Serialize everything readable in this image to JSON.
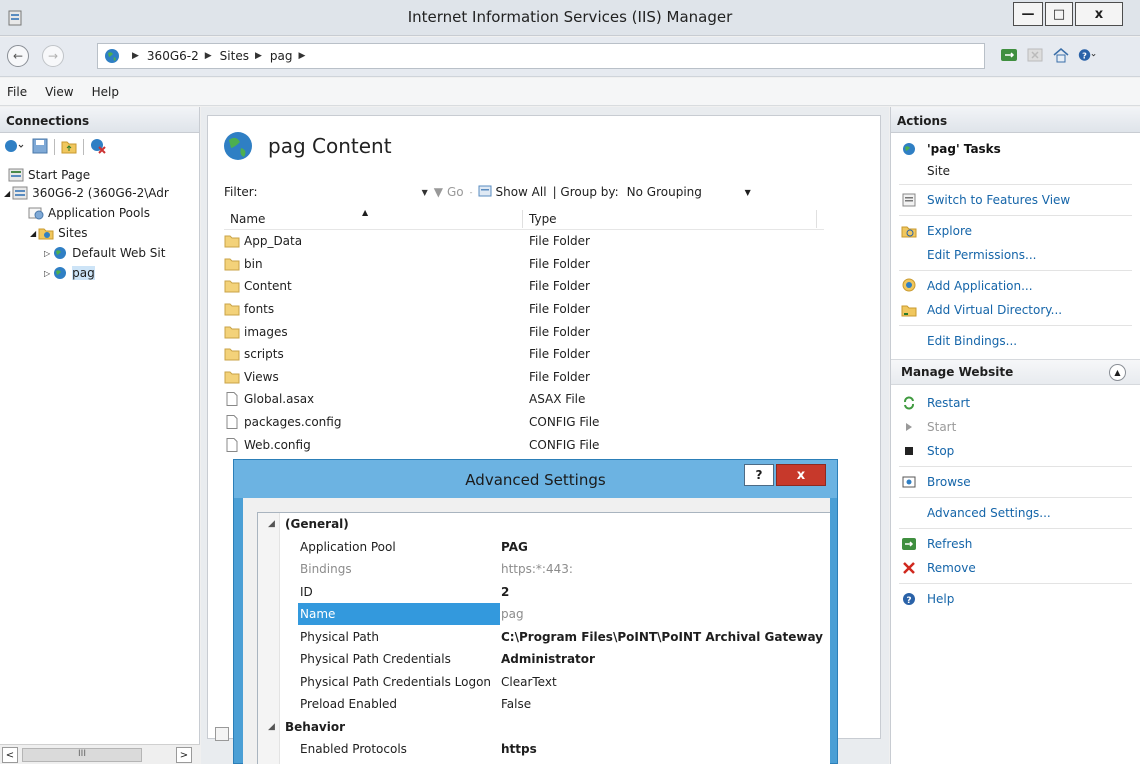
{
  "window": {
    "title": "Internet Information Services (IIS) Manager",
    "minimize": "—",
    "maximize": "□",
    "close": "x"
  },
  "address": {
    "crumbs": [
      "360G6-2",
      "Sites",
      "pag"
    ]
  },
  "menu": {
    "items": [
      "File",
      "View",
      "Help"
    ]
  },
  "connections": {
    "header": "Connections",
    "tree": [
      {
        "label": "Start Page",
        "icon": "start-page-icon"
      },
      {
        "label": "360G6-2 (360G6-2\\Adr",
        "icon": "server-icon"
      },
      {
        "label": "Application Pools",
        "icon": "app-pools-icon"
      },
      {
        "label": "Sites",
        "icon": "sites-folder-icon"
      },
      {
        "label": "Default Web Sit",
        "icon": "website-globe-icon"
      },
      {
        "label": "pag",
        "icon": "website-globe-icon"
      }
    ],
    "scroll_thumb": "III"
  },
  "content": {
    "title": "pag Content",
    "filter_label": "Filter:",
    "go_label": "Go",
    "show_all_label": "Show All",
    "group_by_label": "| Group by:",
    "group_by_value": "No Grouping",
    "columns": {
      "name": "Name",
      "type": "Type"
    },
    "files": [
      {
        "name": "App_Data",
        "type": "File Folder",
        "kind": "folder"
      },
      {
        "name": "bin",
        "type": "File Folder",
        "kind": "folder"
      },
      {
        "name": "Content",
        "type": "File Folder",
        "kind": "folder"
      },
      {
        "name": "fonts",
        "type": "File Folder",
        "kind": "folder"
      },
      {
        "name": "images",
        "type": "File Folder",
        "kind": "folder"
      },
      {
        "name": "scripts",
        "type": "File Folder",
        "kind": "folder"
      },
      {
        "name": "Views",
        "type": "File Folder",
        "kind": "folder"
      },
      {
        "name": "Global.asax",
        "type": "ASAX File",
        "kind": "file"
      },
      {
        "name": "packages.config",
        "type": "CONFIG File",
        "kind": "file"
      },
      {
        "name": "Web.config",
        "type": "CONFIG File",
        "kind": "file"
      }
    ]
  },
  "actions": {
    "header": "Actions",
    "tasks_title": "'pag' Tasks",
    "site_label": "Site",
    "items_group1": [
      {
        "label": "Switch to Features View",
        "icon": "features-view-icon"
      }
    ],
    "explore": "Explore",
    "edit_permissions": "Edit Permissions...",
    "add_application": "Add Application...",
    "add_virtual_directory": "Add Virtual Directory...",
    "edit_bindings": "Edit Bindings...",
    "manage_website": "Manage Website",
    "restart": "Restart",
    "start": "Start",
    "stop": "Stop",
    "browse": "Browse",
    "advanced_settings": "Advanced Settings...",
    "refresh": "Refresh",
    "remove": "Remove",
    "help": "Help"
  },
  "dialog": {
    "title": "Advanced Settings",
    "help_btn": "?",
    "close_btn": "x",
    "rows": [
      {
        "type": "cat",
        "key": "(General)",
        "exp": "◢"
      },
      {
        "key": "Application Pool",
        "value": "PAG",
        "bold": true
      },
      {
        "key": "Bindings",
        "value": "https:*:443:",
        "gray": true
      },
      {
        "key": "ID",
        "value": "2",
        "bold": true
      },
      {
        "key": "Name",
        "value": "pag",
        "selected": true
      },
      {
        "key": "Physical Path",
        "value": "C:\\Program Files\\PoINT\\PoINT Archival Gateway",
        "bold": true
      },
      {
        "key": "Physical Path Credentials",
        "value": "Administrator",
        "bold": true
      },
      {
        "key": "Physical Path Credentials Logon",
        "value": "ClearText"
      },
      {
        "key": "Preload Enabled",
        "value": "False"
      },
      {
        "type": "cat",
        "key": "Behavior",
        "exp": "◢"
      },
      {
        "key": "Enabled Protocols",
        "value": "https",
        "bold": true
      }
    ]
  },
  "colors": {
    "link": "#1565a9",
    "dialog_frame": "#4b9fd5",
    "selection": "#3399dd",
    "close_red": "#c7392b"
  }
}
